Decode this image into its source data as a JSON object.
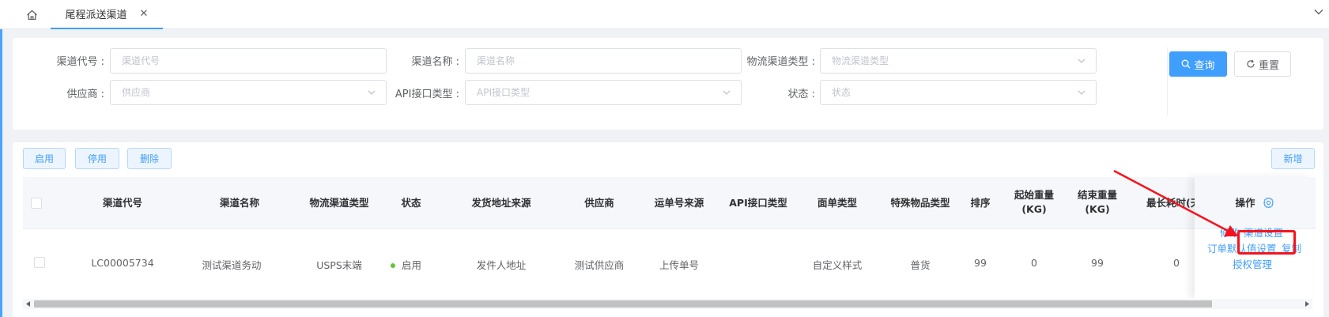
{
  "tabs": {
    "active_label": "尾程派送渠道",
    "close_glyph": "✕"
  },
  "filters": {
    "channel_code": {
      "label": "渠道代号 :",
      "placeholder": "渠道代号"
    },
    "channel_name": {
      "label": "渠道名称 :",
      "placeholder": "渠道名称"
    },
    "logistics_type": {
      "label": "物流渠道类型 :",
      "placeholder": "物流渠道类型"
    },
    "supplier": {
      "label": "供应商 :",
      "placeholder": "供应商"
    },
    "api_type": {
      "label": "API接口类型 :",
      "placeholder": "API接口类型"
    },
    "status": {
      "label": "状态 :",
      "placeholder": "状态"
    },
    "query_label": "查询",
    "reset_label": "重置"
  },
  "toolbar": {
    "enable_label": "启用",
    "disable_label": "停用",
    "delete_label": "删除",
    "add_label": "新增"
  },
  "table": {
    "headers": {
      "channel_code": "渠道代号",
      "channel_name": "渠道名称",
      "logistics_type": "物流渠道类型",
      "status": "状态",
      "ship_from_source": "发货地址来源",
      "supplier": "供应商",
      "waybill_source": "运单号来源",
      "api_type": "API接口类型",
      "label_type": "面单类型",
      "special_goods_type": "特殊物品类型",
      "sort": "排序",
      "start_weight_1": "起始重量",
      "start_weight_2": "(KG)",
      "end_weight_1": "结束重量",
      "end_weight_2": "(KG)",
      "max_time": "最长耗时(天",
      "actions": "操作"
    },
    "row": {
      "channel_code": "LC00005734",
      "channel_name": "测试渠道务动",
      "logistics_type": "USPS末端",
      "status": "启用",
      "ship_from_source": "发件人地址",
      "supplier": "测试供应商",
      "waybill_source": "上传单号",
      "api_type": "",
      "label_type": "自定义样式",
      "special_goods_type": "普货",
      "sort": "99",
      "start_weight": "0",
      "end_weight": "99",
      "max_time": "0"
    },
    "actions": {
      "edit": "修改",
      "channel_settings": "渠道设置",
      "order_default": "订单默认值设置",
      "copy": "复制",
      "auth_manage": "授权管理"
    }
  },
  "colors": {
    "primary": "#409eff",
    "highlight": "#f5141e",
    "status_enabled": "#67c23a"
  }
}
